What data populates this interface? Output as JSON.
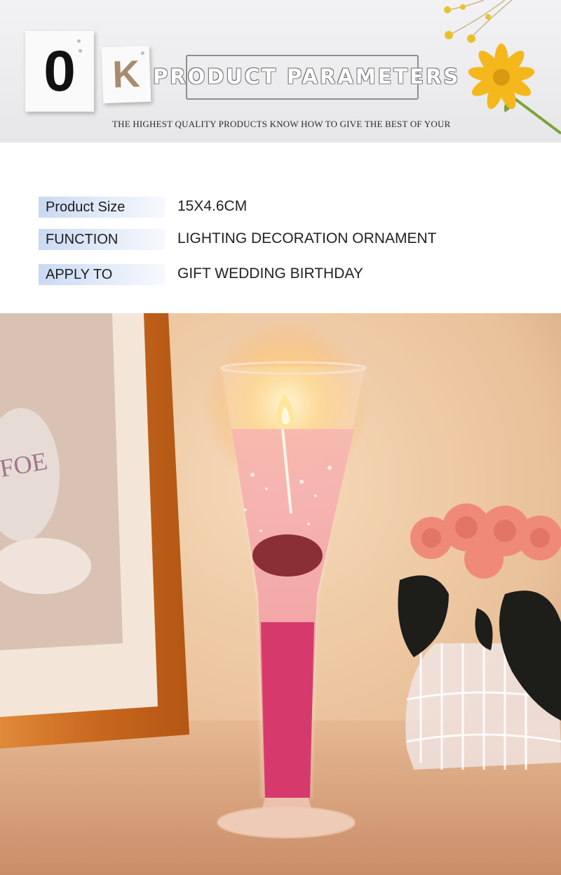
{
  "banner": {
    "letter_o": "0",
    "letter_k": "K",
    "title": "PRODUCT PARAMETERS",
    "tagline": "THE HIGHEST QUALITY PRODUCTS KNOW HOW TO GIVE THE BEST OF YOUR"
  },
  "params": [
    {
      "label": "Product Size",
      "value": "15X4.6CM"
    },
    {
      "label": "FUNCTION",
      "value": "LIGHTING DECORATION ORNAMENT"
    },
    {
      "label": "APPLY TO",
      "value": "GIFT WEDDING BIRTHDAY"
    }
  ],
  "colors": {
    "label_bg": "#c9d9f2",
    "candle_gel": "#e8517a",
    "flame": "#ffd36a",
    "roses": "#f08a78"
  }
}
